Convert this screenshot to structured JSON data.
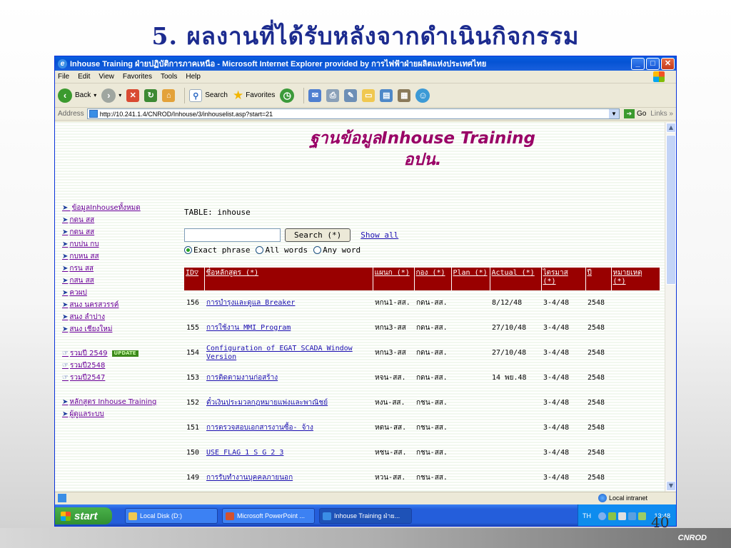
{
  "slide": {
    "title": "5. ผลงานที่ได้รับหลังจากดำเนินกิจกรรม",
    "footer": "CNROD",
    "page_number": "40"
  },
  "window": {
    "title": "Inhouse Training ฝ่ายปฏิบัติการภาคเหนือ - Microsoft Internet Explorer provided by การไฟฟ้าฝ่ายผลิตแห่งประเทศไทย",
    "controls": {
      "minimize": "_",
      "maximize": "□",
      "close": "✕"
    }
  },
  "menubar": {
    "items": [
      "File",
      "Edit",
      "View",
      "Favorites",
      "Tools",
      "Help"
    ]
  },
  "toolbar": {
    "back": "Back",
    "search": "Search",
    "favorites": "Favorites"
  },
  "addressbar": {
    "label": "Address",
    "url": "http://10.241.1.4/CNROD/Inhouse/3/inhouselist.asp?start=21",
    "go": "Go",
    "links": "Links"
  },
  "page": {
    "heading_line1": "ฐานข้อมูลInhouse Training",
    "heading_line2": "อปน.",
    "table_label": "TABLE: inhouse",
    "search_button": "Search (*)",
    "show_all": "Show all",
    "radios": [
      {
        "label": "Exact phrase",
        "checked": true
      },
      {
        "label": "All words",
        "checked": false
      },
      {
        "label": "Any word",
        "checked": false
      }
    ]
  },
  "sidebar": {
    "items": [
      {
        "label": "ข้อมูลInhouseทั้งหมด",
        "prefix": "➤ "
      },
      {
        "label": "กดน สส",
        "prefix": "➤"
      },
      {
        "label": "กดน สส",
        "prefix": "➤"
      },
      {
        "label": "กบปน กบ",
        "prefix": "➤"
      },
      {
        "label": "กบหน สส",
        "prefix": "➤"
      },
      {
        "label": "กรน สส",
        "prefix": "➤"
      },
      {
        "label": "กสน สส",
        "prefix": "➤"
      },
      {
        "label": "ควผป",
        "prefix": "➤"
      },
      {
        "label": "สนง นครสวรรค์",
        "prefix": "➤"
      },
      {
        "label": "สนง ลำปาง",
        "prefix": "➤"
      },
      {
        "label": "สนง เชียงใหม่",
        "prefix": "➤"
      }
    ],
    "summary": [
      {
        "label": "รวมปี 2549",
        "prefix": "☞",
        "badge": "UPDATE"
      },
      {
        "label": "รวมปี2548",
        "prefix": "☞",
        "badge": ""
      },
      {
        "label": "รวมปี2547",
        "prefix": "☞",
        "badge": ""
      }
    ],
    "extras": [
      {
        "label": "หลักสูตร Inhouse Training",
        "prefix": "➤"
      },
      {
        "label": "ผู้ดูแลระบบ",
        "prefix": "➤"
      }
    ]
  },
  "table": {
    "headers": [
      "ID▽",
      "ชื่อหลักสูตร (*)",
      "แผนก (*)",
      "กอง (*)",
      "Plan (*)",
      "Actual (*)",
      "ไตรมาส (*)",
      "ปี",
      "หมายเหตุ (*)"
    ],
    "rows": [
      [
        "156",
        "การบำรุงและดูแล Breaker",
        "หกน1-สส.",
        "กดน-สส.",
        "",
        "8/12/48",
        "3-4/48",
        "2548",
        ""
      ],
      [
        "155",
        "การใช้งาน MMI Program",
        "หกน3-สส",
        "กดน-สส.",
        "",
        "27/10/48",
        "3-4/48",
        "2548",
        ""
      ],
      [
        "154",
        "Configuration of EGAT SCADA Window Version",
        "หกน3-สส",
        "กดน-สส.",
        "",
        "27/10/48",
        "3-4/48",
        "2548",
        ""
      ],
      [
        "153",
        "การติดตามงานก่อสร้าง",
        "หจน-สส.",
        "กดน-สส.",
        "",
        "14 พย.48",
        "3-4/48",
        "2548",
        ""
      ],
      [
        "152",
        "ตั๋วเงินประมวลกฎหมายแพ่งและพาณิชย์",
        "หงน-สส.",
        "กชน-สส.",
        "",
        "",
        "3-4/48",
        "2548",
        ""
      ],
      [
        "151",
        "การตรวจสอบเอกสารงานซื้อ- จ้าง",
        "หตน-สส.",
        "กชน-สส.",
        "",
        "",
        "3-4/48",
        "2548",
        ""
      ],
      [
        "150",
        "USE FLAG 1 S G 2 3",
        "หชน-สส.",
        "กชน-สส.",
        "",
        "",
        "3-4/48",
        "2548",
        ""
      ],
      [
        "149",
        "การรับทำงานบุคคลภายนอก",
        "หวน-สส.",
        "กชน-สส.",
        "",
        "",
        "3-4/48",
        "2548",
        ""
      ]
    ]
  },
  "statusbar": {
    "zone": "Local intranet"
  },
  "taskbar": {
    "start": "start",
    "tasks": [
      "Local Disk (D:)",
      "Microsoft PowerPoint ...",
      "Inhouse Training ฝ่าย..."
    ],
    "lang": "TH",
    "clock": "13:48"
  },
  "colors": {
    "header_bg": "#990000",
    "link": "#1b0fb0",
    "heading": "#990066",
    "slide_title": "#1c2b8f"
  }
}
